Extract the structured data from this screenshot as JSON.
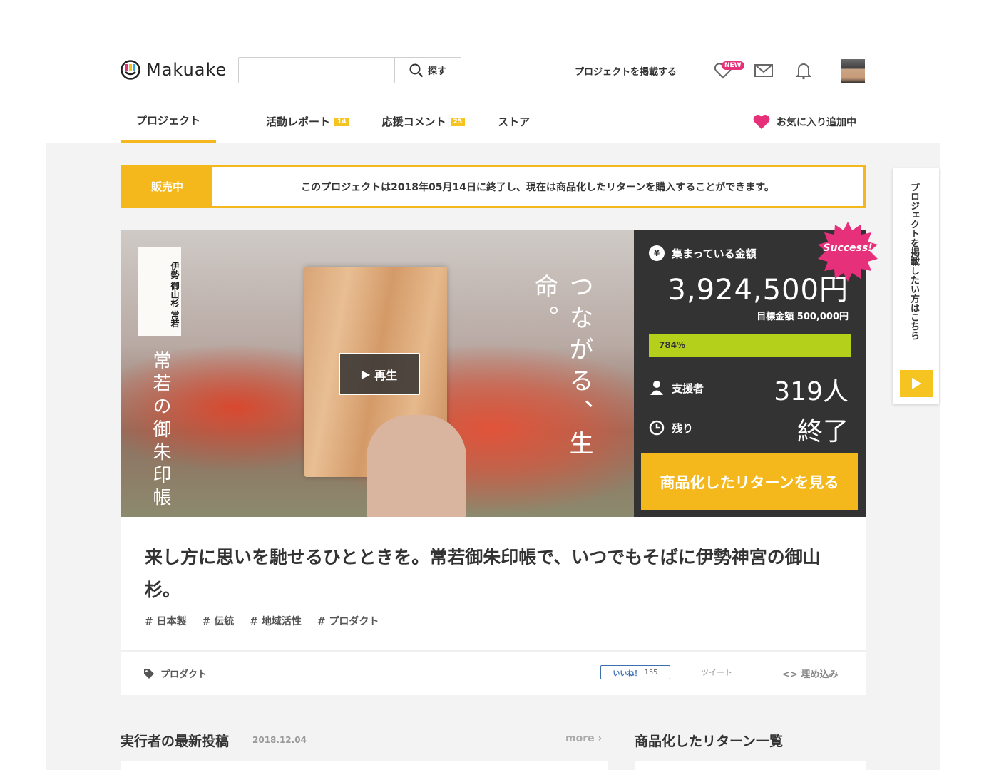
{
  "brand": {
    "name": "Makuake"
  },
  "search": {
    "placeholder": "",
    "value": "",
    "button": "探す"
  },
  "header": {
    "post_project": "プロジェクトを掲載する",
    "new_badge": "NEW"
  },
  "tabs": [
    {
      "label": "プロジェクト",
      "active": true
    },
    {
      "label": "活動レポート",
      "count": "14"
    },
    {
      "label": "応援コメント",
      "count": "25"
    },
    {
      "label": "ストア"
    }
  ],
  "favorite": {
    "label": "お気に入り追加中"
  },
  "notice": {
    "label": "販売中",
    "text": "このプロジェクトは2018年05月14日に終了し、現在は商品化したリターンを購入することができます。"
  },
  "hero": {
    "label_lines": "伊勢 御山杉 常若",
    "caption_left": "常若の御朱印帳",
    "caption_right": "つながる、生命。",
    "play": "再生"
  },
  "stats": {
    "collected_label": "集まっている金額",
    "amount": "3,924,500円",
    "goal": "目標金額 500,000円",
    "percent": "784%",
    "progress_fraction": 1.0,
    "supporters_label": "支援者",
    "supporters": "319人",
    "remaining_label": "残り",
    "remaining": "終了",
    "cta": "商品化したリターンを見る",
    "success": "Success!"
  },
  "side_tab": {
    "text": "プロジェクトを掲載したい方はこちら"
  },
  "project": {
    "title": "来し方に思いを馳せるひとときを。常若御朱印帳で、いつでもそばに伊勢神宮の御山杉。",
    "tags": [
      "# 日本製",
      "# 伝統",
      "# 地域活性",
      "# プロダクト"
    ],
    "category": "プロダクト",
    "like_label": "いいね！",
    "like_count": "155",
    "tweet": "ツイート",
    "embed": "埋め込み"
  },
  "bottom": {
    "latest_title": "実行者の最新投稿",
    "latest_date": "2018.12.04",
    "more": "more",
    "returns_title": "商品化したリターン一覧"
  },
  "colors": {
    "accent": "#f5b81c",
    "progress": "#b5d01b",
    "pink": "#e6307a",
    "panel": "#333333"
  }
}
